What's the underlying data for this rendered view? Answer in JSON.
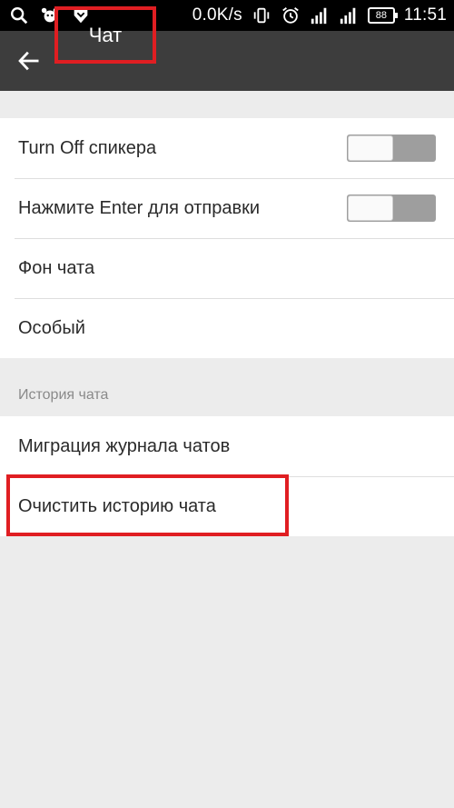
{
  "status_bar": {
    "speed": "0.0K/s",
    "battery": "88",
    "time": "11:51"
  },
  "toolbar": {
    "title": "Чат"
  },
  "settings": {
    "speaker_label": "Turn Off спикера",
    "enter_send_label": "Нажмите Enter для отправки",
    "background_label": "Фон чата",
    "custom_label": "Особый"
  },
  "history": {
    "section_title": "История чата",
    "migration_label": "Миграция журнала чатов",
    "clear_label": "Очистить историю чата"
  },
  "colors": {
    "toolbar": "#3d3d3d",
    "highlight": "#e01e22",
    "toggle_off_track": "#9e9e9e"
  }
}
